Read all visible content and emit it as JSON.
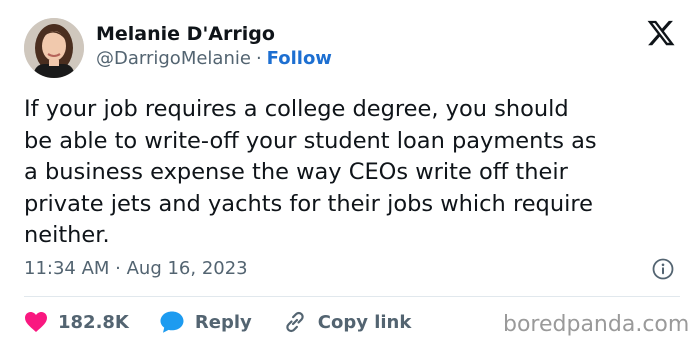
{
  "author": {
    "name": "Melanie D'Arrigo",
    "handle": "@DarrigoMelanie",
    "separator": "·",
    "follow_label": "Follow",
    "avatar_icon": "profile-photo"
  },
  "logo_icon": "x-logo-icon",
  "tweet": {
    "text": "If your job requires a college degree, you should\nbe able to write-off your student loan payments as\na business expense the way CEOs write off their\nprivate jets and yachts for their jobs which require\nneither."
  },
  "meta": {
    "timestamp": "11:34 AM · Aug 16, 2023",
    "info_icon": "info-icon"
  },
  "actions": {
    "likes": {
      "count": "182.8K",
      "icon": "heart-icon",
      "color": "#f91880"
    },
    "reply": {
      "label": "Reply",
      "icon": "reply-bubble-icon",
      "color": "#1d9bf0"
    },
    "copy": {
      "label": "Copy link",
      "icon": "link-icon"
    }
  },
  "watermark": "boredpanda.com"
}
